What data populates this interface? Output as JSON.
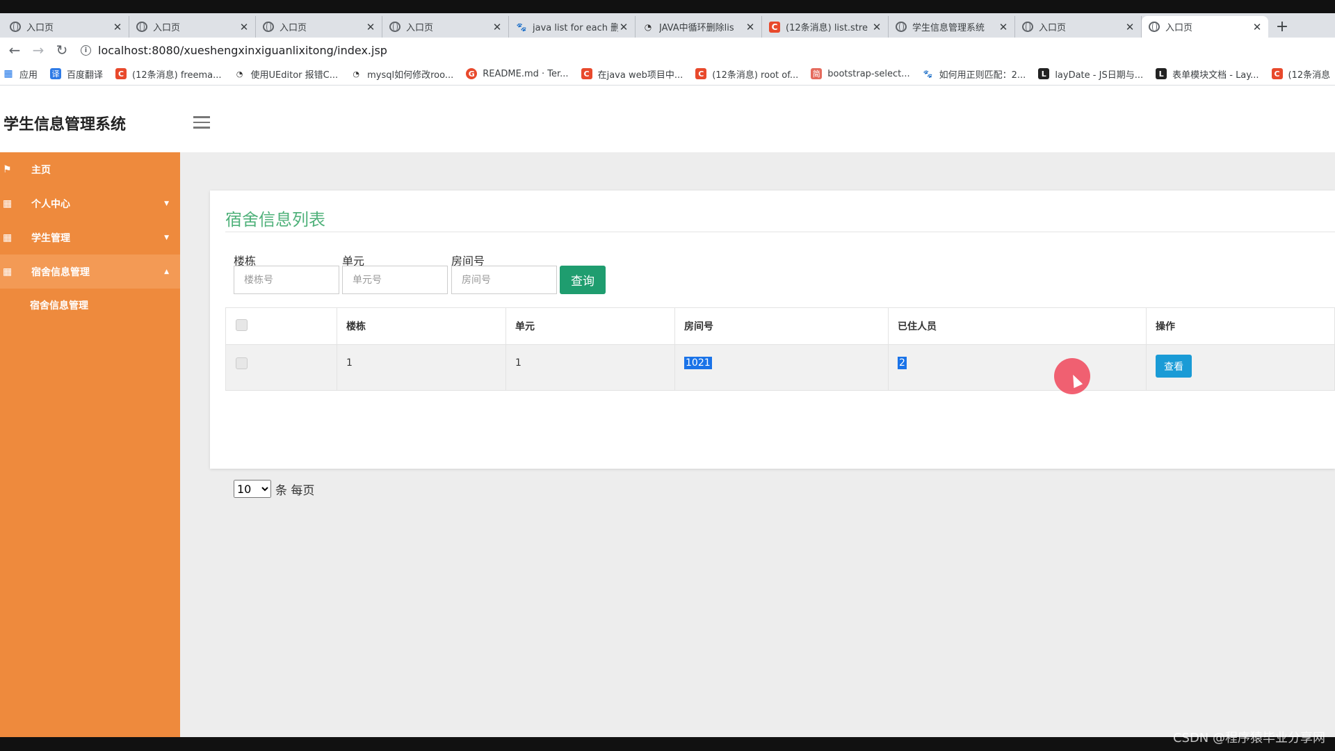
{
  "browser": {
    "tabs": [
      {
        "title": "入口页",
        "icon": "globe-icon",
        "active": false
      },
      {
        "title": "入口页",
        "icon": "globe-icon",
        "active": false
      },
      {
        "title": "入口页",
        "icon": "globe-icon",
        "active": false
      },
      {
        "title": "入口页",
        "icon": "globe-icon",
        "active": false
      },
      {
        "title": "java list for each 删",
        "icon": "baidu-paw-icon",
        "active": false
      },
      {
        "title": "JAVA中循环删除lis",
        "icon": "yuque-icon",
        "active": false
      },
      {
        "title": "(12条消息) list.stre",
        "icon": "csdn-icon",
        "active": false
      },
      {
        "title": "学生信息管理系统",
        "icon": "globe-icon",
        "active": false
      },
      {
        "title": "入口页",
        "icon": "globe-icon",
        "active": false
      },
      {
        "title": "入口页",
        "icon": "globe-icon",
        "active": true
      }
    ],
    "new_tab": "+",
    "close_glyph": "✕",
    "url": "localhost:8080/xueshengxinxiguanlixitong/index.jsp",
    "bookmarks": [
      {
        "label": "应用",
        "icon": "apps-grid-icon"
      },
      {
        "label": "百度翻译",
        "icon": "baidu-translate-icon"
      },
      {
        "label": "(12条消息) freema...",
        "icon": "csdn-icon"
      },
      {
        "label": "使用UEditor 报错C...",
        "icon": "yuque-icon"
      },
      {
        "label": "mysql如何修改roo...",
        "icon": "yuque-icon"
      },
      {
        "label": "README.md · Ter...",
        "icon": "gitee-icon"
      },
      {
        "label": "在java web项目中...",
        "icon": "csdn-icon"
      },
      {
        "label": "(12条消息) root of...",
        "icon": "csdn-icon"
      },
      {
        "label": "bootstrap-select...",
        "icon": "jianshu-icon"
      },
      {
        "label": "如何用正则匹配：2...",
        "icon": "baidu-paw-icon"
      },
      {
        "label": "layDate - JS日期与...",
        "icon": "layui-icon"
      },
      {
        "label": "表单模块文档 - Lay...",
        "icon": "layui-icon"
      },
      {
        "label": "(12条消息",
        "icon": "csdn-icon"
      }
    ]
  },
  "app": {
    "brand": "学生信息管理系统",
    "sidebar": {
      "items": [
        {
          "label": "主页",
          "icon": "flag-icon"
        },
        {
          "label": "个人中心",
          "icon": "grid-icon",
          "caret": "▼"
        },
        {
          "label": "学生管理",
          "icon": "grid-icon",
          "caret": "▼"
        },
        {
          "label": "宿舍信息管理",
          "icon": "grid-icon",
          "caret": "▲"
        }
      ],
      "sub_items": [
        "宿舍信息管理"
      ]
    },
    "card": {
      "title": "宿舍信息列表",
      "search": {
        "building": {
          "label": "楼栋",
          "placeholder": "楼栋号",
          "value": ""
        },
        "unit": {
          "label": "单元",
          "placeholder": "单元号",
          "value": ""
        },
        "room": {
          "label": "房间号",
          "placeholder": "房间号",
          "value": ""
        },
        "button": "查询"
      },
      "table": {
        "headers": [
          "楼栋",
          "单元",
          "房间号",
          "已住人员",
          "操作"
        ],
        "rows": [
          {
            "building": "1",
            "unit": "1",
            "room": "1021",
            "occupants": "2",
            "action": "查看"
          }
        ]
      },
      "pager": {
        "page_size": "10",
        "suffix": "条 每页"
      }
    }
  },
  "watermark": "CSDN @程序猿毕业分享网",
  "colors": {
    "sidebar": "#ee8a3d",
    "title_green": "#4fb17a",
    "query_button": "#1f9d6f",
    "view_button": "#1a9bd6"
  }
}
